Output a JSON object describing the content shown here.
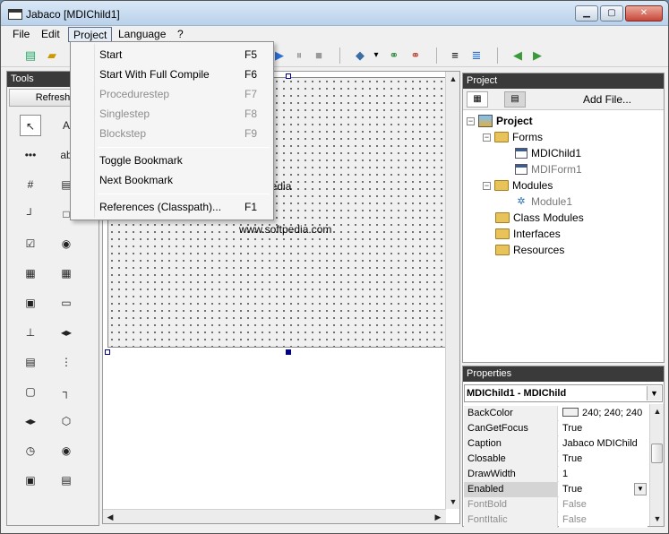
{
  "window": {
    "title": "Jabaco [MDIChild1]",
    "min": "▁",
    "max": "▢",
    "close": "✕"
  },
  "menubar": [
    "File",
    "Edit",
    "Project",
    "Language",
    "?"
  ],
  "project_menu": {
    "items": [
      {
        "label": "Start",
        "shortcut": "F5"
      },
      {
        "label": "Start With Full Compile",
        "shortcut": "F6"
      },
      {
        "label": "Procedurestep",
        "shortcut": "F7"
      },
      {
        "label": "Singlestep",
        "shortcut": "F8"
      },
      {
        "label": "Blockstep",
        "shortcut": "F9"
      },
      {
        "label": "Toggle Bookmark",
        "shortcut": ""
      },
      {
        "label": "Next Bookmark",
        "shortcut": ""
      },
      {
        "label": "References (Classpath)...",
        "shortcut": "F1"
      }
    ]
  },
  "toolbar": {
    "icons": [
      "new-project-icon",
      "open-folder-icon",
      "play-icon",
      "pause-icon",
      "stop-icon",
      "tag-icon",
      "dropdown-arrow-icon",
      "link-add-icon",
      "link-remove-icon",
      "indent-icon",
      "outdent-icon",
      "back-arrow-icon",
      "forward-arrow-icon"
    ],
    "glyphs": {
      "new": "▤",
      "open": "▰",
      "play": "▶",
      "pause": "⏸",
      "stop": "■",
      "tag": "◆",
      "drop": "▾",
      "link_add": "⚭",
      "link_remove": "⚭",
      "indent": "≡",
      "outdent": "≣",
      "back": "◀",
      "forward": "▶"
    }
  },
  "tools": {
    "header": "Tools",
    "refresh": "Refresh",
    "glyphs": [
      "↖",
      "A",
      "•••",
      "ab",
      "#",
      "▤",
      "┘",
      "□",
      "☑",
      "◉",
      "▦",
      "▦",
      "▣",
      "▭",
      "⊥",
      "◂▸",
      "▤",
      "⋮",
      "▢",
      "┐",
      "◂▸",
      "⬡",
      "◷",
      "◉",
      "▣",
      "▤"
    ]
  },
  "designer": {
    "text1": "pedia",
    "text2": "www.softpedia.com",
    "watermark": "www.softpedia.com",
    "up": "▲",
    "down": "▼",
    "left": "◀",
    "right": "▶"
  },
  "project_panel": {
    "header": "Project",
    "add_file": "Add File...",
    "btn_code": "▦",
    "btn_form": "▤",
    "tree": [
      {
        "label": "Project",
        "expander": "−"
      },
      {
        "label": "Forms",
        "expander": "−"
      },
      {
        "label": "MDIChild1",
        "expander": ""
      },
      {
        "label": "MDIForm1",
        "expander": ""
      },
      {
        "label": "Modules",
        "expander": "−"
      },
      {
        "label": "Module1",
        "expander": ""
      },
      {
        "label": "Class Modules",
        "expander": ""
      },
      {
        "label": "Interfaces",
        "expander": ""
      },
      {
        "label": "Resources",
        "expander": ""
      }
    ],
    "module_glyph": "✲"
  },
  "properties": {
    "header": "Properties",
    "object": "MDIChild1 - MDIChild",
    "drop": "▼",
    "up": "▲",
    "down": "▼",
    "rows": [
      {
        "name": "BackColor",
        "value": "240; 240; 240"
      },
      {
        "name": "CanGetFocus",
        "value": "True"
      },
      {
        "name": "Caption",
        "value": "Jabaco MDIChild"
      },
      {
        "name": "Closable",
        "value": "True"
      },
      {
        "name": "DrawWidth",
        "value": "1"
      },
      {
        "name": "Enabled",
        "value": "True"
      },
      {
        "name": "FontBold",
        "value": "False"
      },
      {
        "name": "FontItalic",
        "value": "False"
      }
    ]
  },
  "colors": {
    "menu_highlight": "#e4ecf6",
    "panel_header": "#3a3a3a",
    "handle": "#00008b"
  }
}
